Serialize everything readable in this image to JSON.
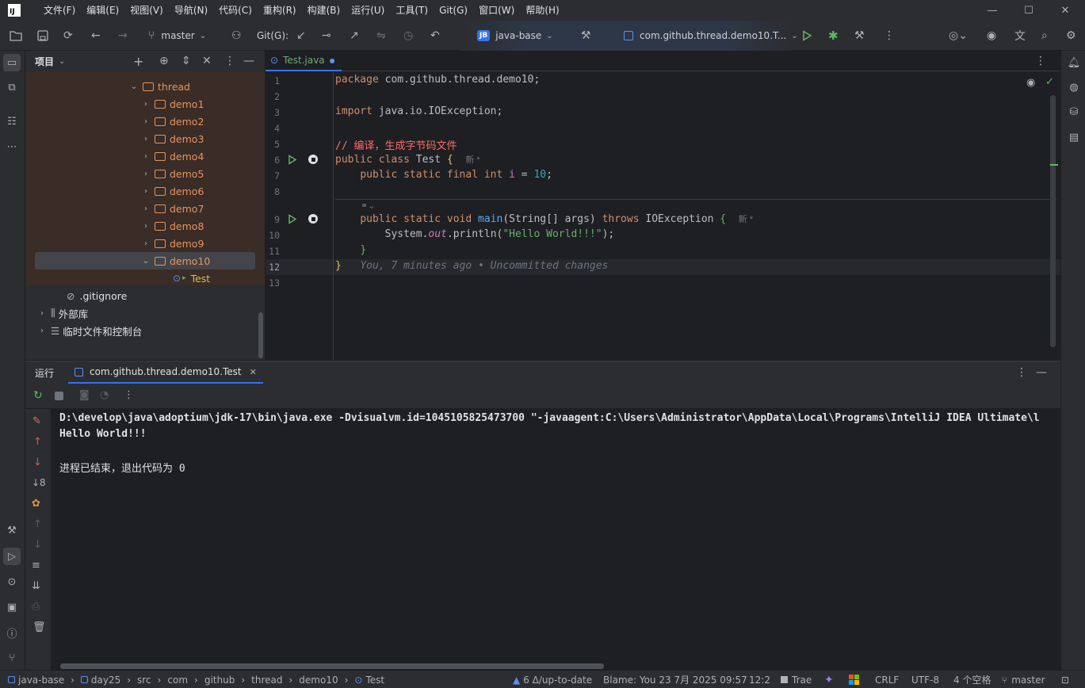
{
  "menu": [
    "文件(F)",
    "编辑(E)",
    "视图(V)",
    "导航(N)",
    "代码(C)",
    "重构(R)",
    "构建(B)",
    "运行(U)",
    "工具(T)",
    "Git(G)",
    "窗口(W)",
    "帮助(H)"
  ],
  "toolbar": {
    "branch": "master",
    "git_label": "Git(G):",
    "project_badge": "JB",
    "project_name": "java-base",
    "run_config": "com.github.thread.demo10.T..."
  },
  "project_panel": {
    "title": "项目",
    "tree": [
      {
        "label": "thread",
        "depth": 0,
        "open": true
      },
      {
        "label": "demo1",
        "depth": 1
      },
      {
        "label": "demo2",
        "depth": 1
      },
      {
        "label": "demo3",
        "depth": 1
      },
      {
        "label": "demo4",
        "depth": 1
      },
      {
        "label": "demo5",
        "depth": 1
      },
      {
        "label": "demo6",
        "depth": 1
      },
      {
        "label": "demo7",
        "depth": 1
      },
      {
        "label": "demo8",
        "depth": 1
      },
      {
        "label": "demo9",
        "depth": 1
      },
      {
        "label": "demo10",
        "depth": 1,
        "open": true,
        "selected": true
      }
    ],
    "test_file": "Test",
    "gitignore": ".gitignore",
    "external_libs": "外部库",
    "scratches": "临时文件和控制台"
  },
  "editor": {
    "tab_label": "Test.java",
    "lines": [
      "1",
      "2",
      "3",
      "4",
      "5",
      "6",
      "7",
      "8",
      "9",
      "10",
      "11",
      "12",
      "13"
    ],
    "line1_kw": "package",
    "line1_rest": " com.github.thread.demo10;",
    "line3_kw": "import",
    "line3_rest": " java.io.IOException;",
    "line5_comment": "// 编译，生成字节码文件",
    "line6_kw": "public class",
    "line6_name": " Test ",
    "line6_brace": "{",
    "hint_new": "新 *",
    "line7_kw": "public static final int",
    "line7_var": " i",
    "line7_eq": " = ",
    "line7_num": "10",
    "line7_end": ";",
    "line9_kw1": "public static void",
    "line9_fn": " main",
    "line9_args": "(String[] args) ",
    "line9_kw2": "throws",
    "line9_exc": " IOException ",
    "line9_brace": "{",
    "line10_a": "System.",
    "line10_out": "out",
    "line10_b": ".println(",
    "line10_str": "\"Hello World!!!\"",
    "line10_c": ");",
    "line11": "}",
    "line12_brace": "}",
    "blame": "You, 7 minutes ago • Uncommitted changes"
  },
  "run_panel": {
    "title": "运行",
    "tab": "com.github.thread.demo10.Test",
    "console": [
      "D:\\develop\\java\\adoptium\\jdk-17\\bin\\java.exe -Dvisualvm.id=1045105825473700 \"-javaagent:C:\\Users\\Administrator\\AppData\\Local\\Programs\\IntelliJ IDEA Ultimate\\l",
      "Hello World!!!",
      "",
      "进程已结束，退出代码为 0"
    ]
  },
  "statusbar": {
    "breadcrumb": [
      "java-base",
      "day25",
      "src",
      "com",
      "github",
      "thread",
      "demo10",
      "Test"
    ],
    "vcs_status": "6 Δ/up-to-date",
    "blame": "Blame: You 23 7月 2025 09:57",
    "position": "12:2",
    "trae": "Trae",
    "line_sep": "CRLF",
    "encoding": "UTF-8",
    "indent": "4 个空格",
    "branch": "master"
  }
}
